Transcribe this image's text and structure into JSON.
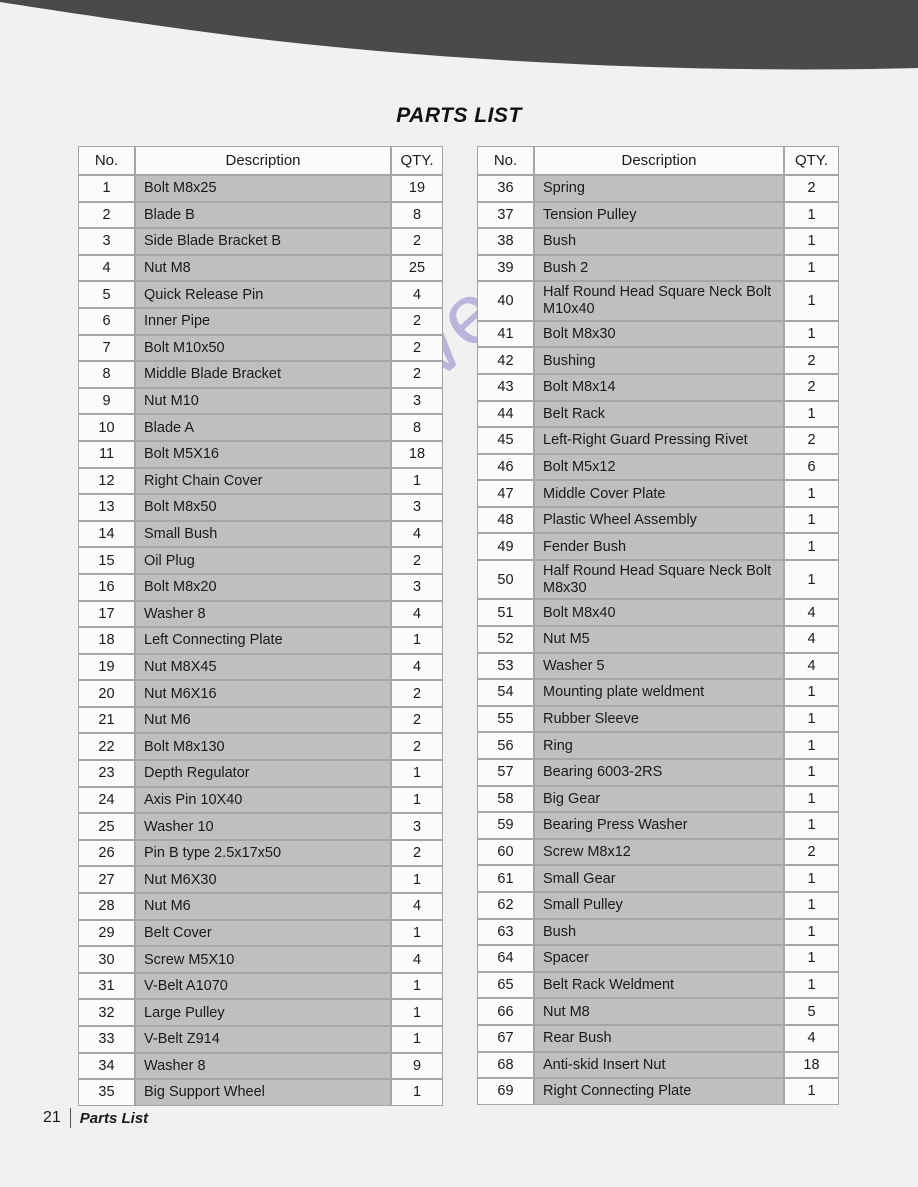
{
  "document": {
    "title": "PARTS LIST",
    "footer": {
      "page_number": "21",
      "section_label": "Parts List"
    },
    "watermark": "manualshive.com",
    "accent_colors": {
      "header_band": "#4a4a4a",
      "page_background": "#f1f1f1",
      "description_cell": "#bfbfbf",
      "number_cell": "#fbfbfb",
      "grid_line": "#a6a6a6",
      "watermark": "#9a93cf"
    }
  },
  "tables": {
    "left": {
      "headers": {
        "no": "No.",
        "description": "Description",
        "qty": "QTY."
      },
      "rows": [
        {
          "no": "1",
          "description": "Bolt M8x25",
          "qty": "19"
        },
        {
          "no": "2",
          "description": "Blade B",
          "qty": "8"
        },
        {
          "no": "3",
          "description": "Side Blade Bracket B",
          "qty": "2"
        },
        {
          "no": "4",
          "description": "Nut M8",
          "qty": "25"
        },
        {
          "no": "5",
          "description": "Quick Release Pin",
          "qty": "4"
        },
        {
          "no": "6",
          "description": "Inner Pipe",
          "qty": "2"
        },
        {
          "no": "7",
          "description": "Bolt M10x50",
          "qty": "2"
        },
        {
          "no": "8",
          "description": "Middle Blade Bracket",
          "qty": "2"
        },
        {
          "no": "9",
          "description": "Nut M10",
          "qty": "3"
        },
        {
          "no": "10",
          "description": "Blade A",
          "qty": "8"
        },
        {
          "no": "11",
          "description": "Bolt M5X16",
          "qty": "18"
        },
        {
          "no": "12",
          "description": "Right Chain Cover",
          "qty": "1"
        },
        {
          "no": "13",
          "description": "Bolt M8x50",
          "qty": "3"
        },
        {
          "no": "14",
          "description": "Small Bush",
          "qty": "4"
        },
        {
          "no": "15",
          "description": "Oil Plug",
          "qty": "2"
        },
        {
          "no": "16",
          "description": "Bolt M8x20",
          "qty": "3"
        },
        {
          "no": "17",
          "description": "Washer 8",
          "qty": "4"
        },
        {
          "no": "18",
          "description": "Left Connecting Plate",
          "qty": "1"
        },
        {
          "no": "19",
          "description": "Nut M8X45",
          "qty": "4"
        },
        {
          "no": "20",
          "description": "Nut M6X16",
          "qty": "2"
        },
        {
          "no": "21",
          "description": "Nut M6",
          "qty": "2"
        },
        {
          "no": "22",
          "description": "Bolt M8x130",
          "qty": "2"
        },
        {
          "no": "23",
          "description": "Depth Regulator",
          "qty": "1"
        },
        {
          "no": "24",
          "description": "Axis Pin 10X40",
          "qty": "1"
        },
        {
          "no": "25",
          "description": "Washer 10",
          "qty": "3"
        },
        {
          "no": "26",
          "description": "Pin B type 2.5x17x50",
          "qty": "2"
        },
        {
          "no": "27",
          "description": "Nut M6X30",
          "qty": "1"
        },
        {
          "no": "28",
          "description": "Nut M6",
          "qty": "4"
        },
        {
          "no": "29",
          "description": "Belt Cover",
          "qty": "1"
        },
        {
          "no": "30",
          "description": "Screw M5X10",
          "qty": "4"
        },
        {
          "no": "31",
          "description": "V-Belt A1070",
          "qty": "1"
        },
        {
          "no": "32",
          "description": "Large Pulley",
          "qty": "1"
        },
        {
          "no": "33",
          "description": "V-Belt Z914",
          "qty": "1"
        },
        {
          "no": "34",
          "description": "Washer 8",
          "qty": "9"
        },
        {
          "no": "35",
          "description": "Big Support Wheel",
          "qty": "1"
        }
      ]
    },
    "right": {
      "headers": {
        "no": "No.",
        "description": "Description",
        "qty": "QTY."
      },
      "rows": [
        {
          "no": "36",
          "description": "Spring",
          "qty": "2"
        },
        {
          "no": "37",
          "description": "Tension Pulley",
          "qty": "1"
        },
        {
          "no": "38",
          "description": "Bush",
          "qty": "1"
        },
        {
          "no": "39",
          "description": "Bush 2",
          "qty": "1"
        },
        {
          "no": "40",
          "description": "Half Round Head Square Neck Bolt M10x40",
          "qty": "1",
          "tall": true
        },
        {
          "no": "41",
          "description": "Bolt M8x30",
          "qty": "1"
        },
        {
          "no": "42",
          "description": "Bushing",
          "qty": "2"
        },
        {
          "no": "43",
          "description": "Bolt M8x14",
          "qty": "2"
        },
        {
          "no": "44",
          "description": "Belt Rack",
          "qty": "1"
        },
        {
          "no": "45",
          "description": "Left-Right Guard Pressing Rivet",
          "qty": "2"
        },
        {
          "no": "46",
          "description": "Bolt M5x12",
          "qty": "6"
        },
        {
          "no": "47",
          "description": "Middle Cover Plate",
          "qty": "1"
        },
        {
          "no": "48",
          "description": "Plastic Wheel Assembly",
          "qty": "1"
        },
        {
          "no": "49",
          "description": "Fender Bush",
          "qty": "1"
        },
        {
          "no": "50",
          "description": "Half Round Head Square Neck Bolt M8x30",
          "qty": "1",
          "tall": true
        },
        {
          "no": "51",
          "description": "Bolt M8x40",
          "qty": "4"
        },
        {
          "no": "52",
          "description": "Nut M5",
          "qty": "4"
        },
        {
          "no": "53",
          "description": "Washer 5",
          "qty": "4"
        },
        {
          "no": "54",
          "description": "Mounting plate weldment",
          "qty": "1"
        },
        {
          "no": "55",
          "description": "Rubber Sleeve",
          "qty": "1"
        },
        {
          "no": "56",
          "description": "Ring",
          "qty": "1"
        },
        {
          "no": "57",
          "description": "Bearing 6003-2RS",
          "qty": "1"
        },
        {
          "no": "58",
          "description": "Big Gear",
          "qty": "1"
        },
        {
          "no": "59",
          "description": "Bearing Press Washer",
          "qty": "1"
        },
        {
          "no": "60",
          "description": "Screw M8x12",
          "qty": "2"
        },
        {
          "no": "61",
          "description": "Small Gear",
          "qty": "1"
        },
        {
          "no": "62",
          "description": "Small Pulley",
          "qty": "1"
        },
        {
          "no": "63",
          "description": "Bush",
          "qty": "1"
        },
        {
          "no": "64",
          "description": "Spacer",
          "qty": "1"
        },
        {
          "no": "65",
          "description": "Belt Rack Weldment",
          "qty": "1"
        },
        {
          "no": "66",
          "description": "Nut M8",
          "qty": "5"
        },
        {
          "no": "67",
          "description": "Rear Bush",
          "qty": "4"
        },
        {
          "no": "68",
          "description": "Anti-skid Insert Nut",
          "qty": "18"
        },
        {
          "no": "69",
          "description": "Right Connecting Plate",
          "qty": "1"
        }
      ]
    }
  }
}
